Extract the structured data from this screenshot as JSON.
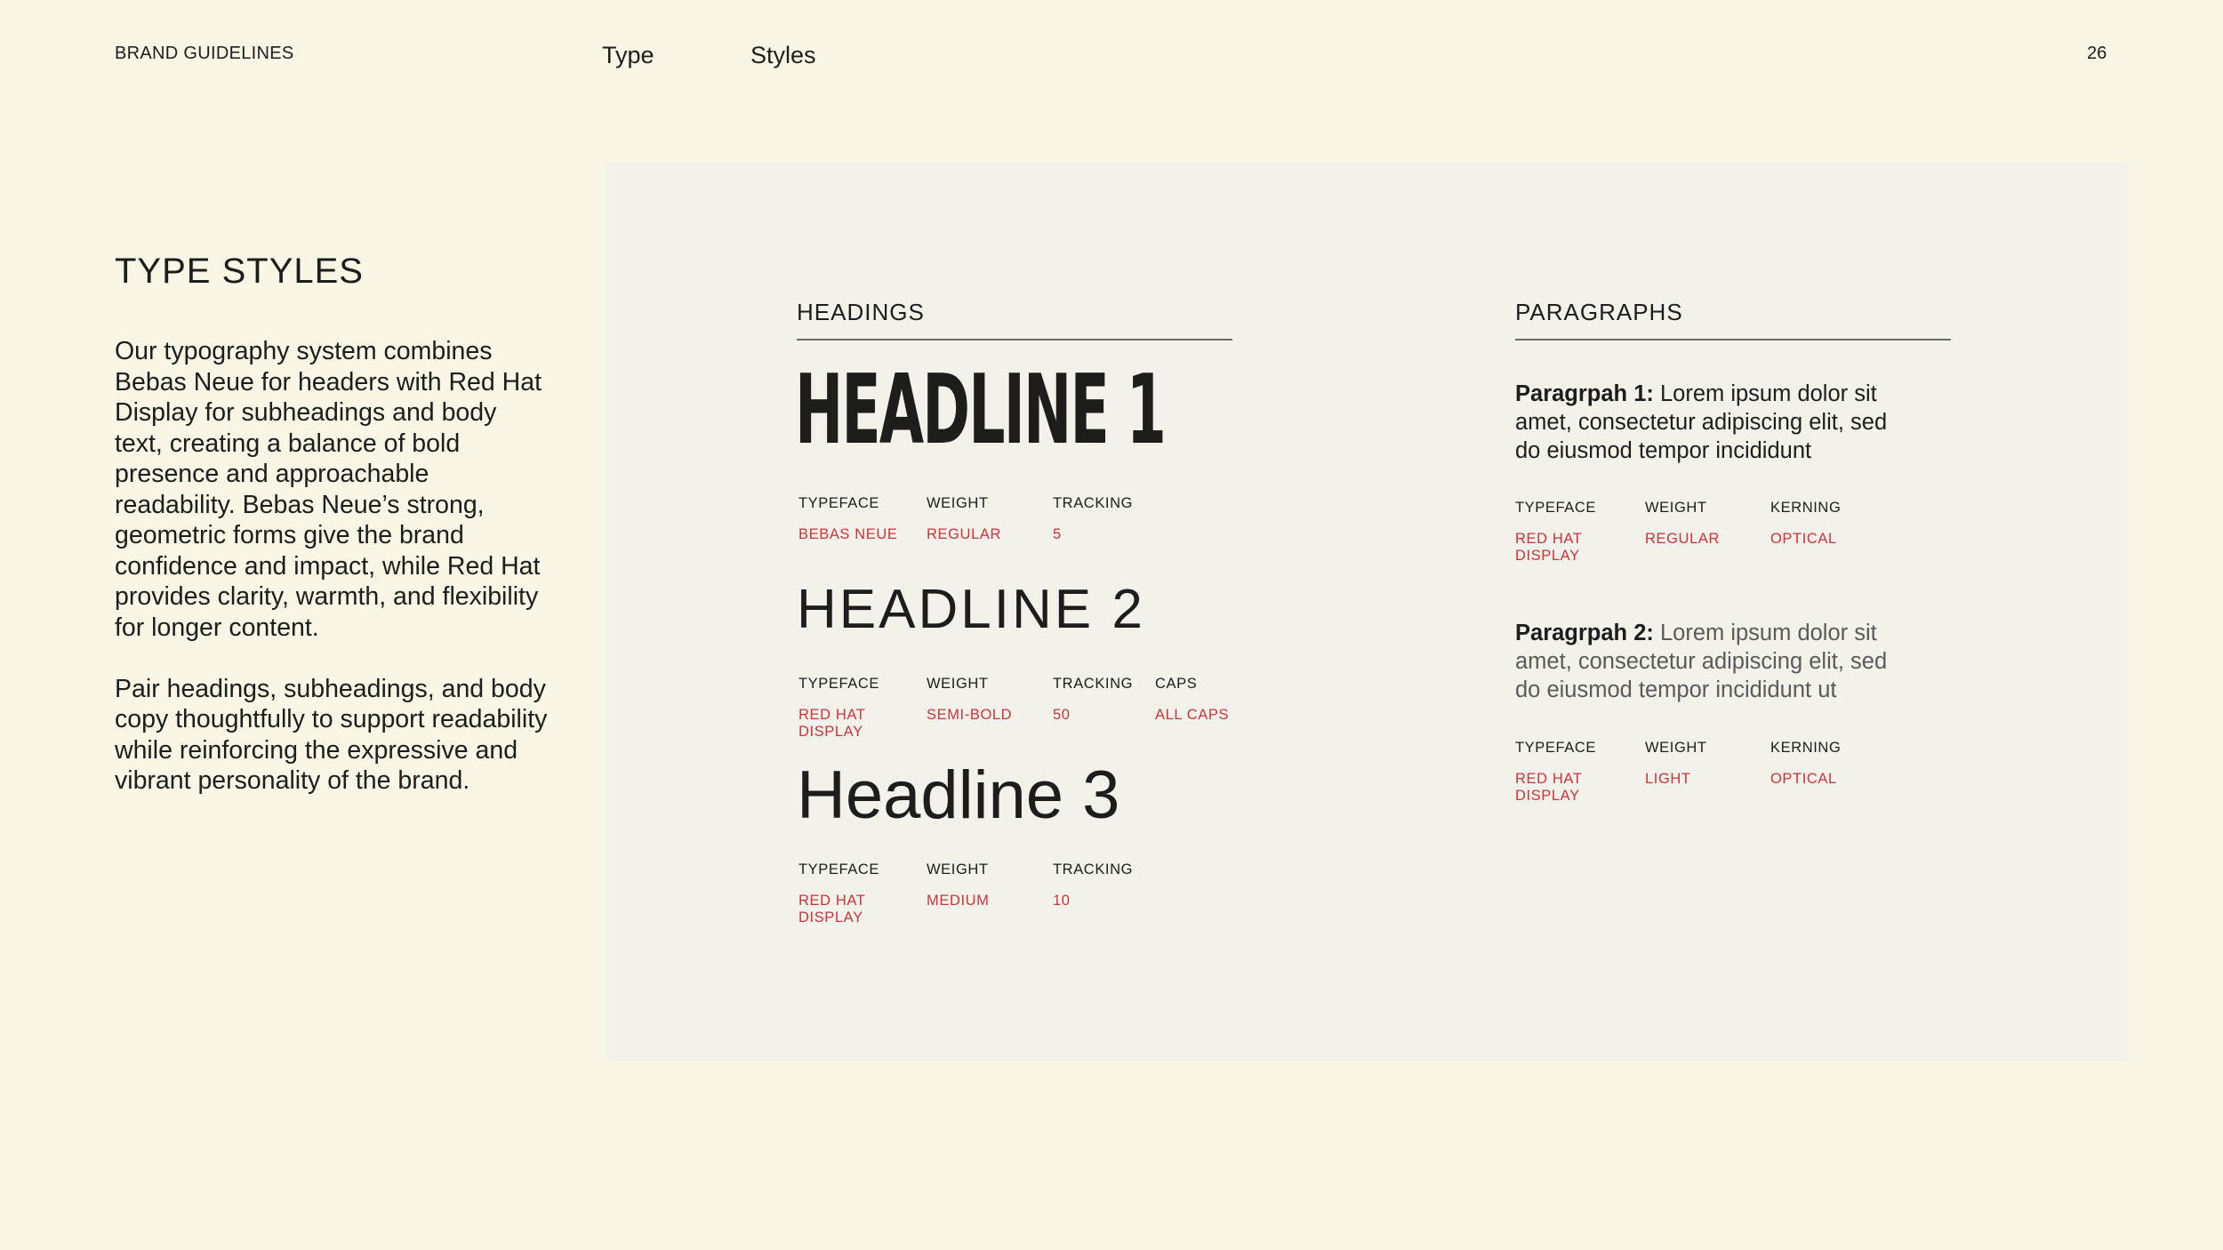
{
  "header": {
    "brand": "BRAND GUIDELINES",
    "nav": [
      "Type",
      "Styles"
    ],
    "page_number": "26"
  },
  "intro": {
    "title": "TYPE STYLES",
    "paragraphs": [
      "Our typography system combines Bebas Neue for headers with Red Hat Display for subheadings and body text, creating a balance of bold presence and approachable readability. Bebas Neue’s strong, geometric forms give the brand confidence and impact, while Red Hat provides clarity, warmth, and flexibility for longer content.",
      "Pair headings, subheadings, and body copy thoughtfully to support readability while reinforcing the expressive and vibrant personality of the brand."
    ]
  },
  "headings": {
    "title": "HEADINGS",
    "items": [
      {
        "sample": "HEADLINE 1",
        "specs": [
          {
            "label": "TYPEFACE",
            "value": "BEBAS NEUE"
          },
          {
            "label": "WEIGHT",
            "value": "REGULAR"
          },
          {
            "label": "TRACKING",
            "value": "5"
          }
        ]
      },
      {
        "sample": "HEADLINE 2",
        "specs": [
          {
            "label": "TYPEFACE",
            "value": "RED HAT DISPLAY"
          },
          {
            "label": "WEIGHT",
            "value": "SEMI-BOLD"
          },
          {
            "label": "TRACKING",
            "value": "50"
          },
          {
            "label": "CAPS",
            "value": "ALL CAPS"
          }
        ]
      },
      {
        "sample": "Headline 3",
        "specs": [
          {
            "label": "TYPEFACE",
            "value": "RED HAT DISPLAY"
          },
          {
            "label": "WEIGHT",
            "value": "MEDIUM"
          },
          {
            "label": "TRACKING",
            "value": "10"
          }
        ]
      }
    ]
  },
  "paragraphs": {
    "title": "PARAGRAPHS",
    "items": [
      {
        "label": "Paragrpah 1:",
        "text": " Lorem ipsum dolor sit amet, consectetur adipiscing elit, sed do eiusmod tempor incididunt",
        "specs": [
          {
            "label": "TYPEFACE",
            "value": "RED HAT DISPLAY"
          },
          {
            "label": "WEIGHT",
            "value": "REGULAR"
          },
          {
            "label": "KERNING",
            "value": "OPTICAL"
          }
        ]
      },
      {
        "label": "Paragrpah 2:",
        "text": " Lorem ipsum dolor sit amet, consectetur adipiscing elit, sed do eiusmod tempor incididunt ut",
        "specs": [
          {
            "label": "TYPEFACE",
            "value": "RED HAT DISPLAY"
          },
          {
            "label": "WEIGHT",
            "value": "LIGHT"
          },
          {
            "label": "KERNING",
            "value": "OPTICAL"
          }
        ]
      }
    ]
  },
  "colors": {
    "background": "#f9f6e6",
    "panel": "#f3f2ea",
    "accent": "#c9333b",
    "text": "#1d1d1b"
  }
}
